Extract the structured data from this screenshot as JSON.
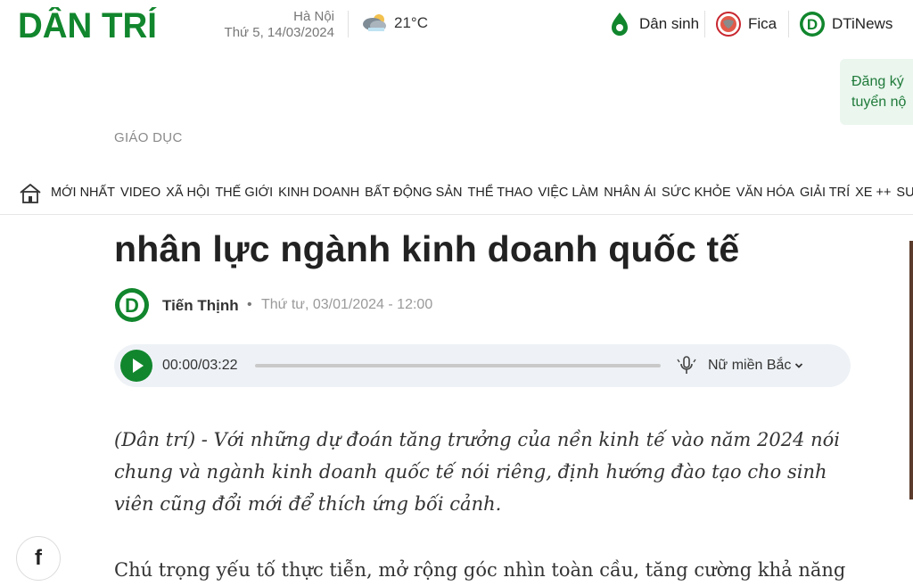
{
  "header": {
    "logo_text": "DÂN TRÍ",
    "location": "Hà Nội",
    "date": "Thứ 5, 14/03/2024",
    "temperature": "21°C",
    "links": [
      {
        "label": "Dân sinh",
        "icon": "dan-sinh-icon"
      },
      {
        "label": "Fica",
        "icon": "fica-globe-icon"
      },
      {
        "label": "DTiNews",
        "icon": "dtinews-logo-icon"
      }
    ],
    "side_cta": {
      "line1": "Đăng ký",
      "line2": "tuyển nộ"
    }
  },
  "breadcrumb": "GIÁO DỤC",
  "nav": {
    "home_icon": "home-icon",
    "items": [
      "MỚI NHẤT",
      "VIDEO",
      "XÃ HỘI",
      "THẾ GIỚI",
      "KINH DOANH",
      "BẤT ĐỘNG SẢN",
      "THỂ THAO",
      "VIỆC LÀM",
      "NHÂN ÁI",
      "SỨC KHỎE",
      "VĂN HÓA",
      "GIẢI TRÍ",
      "XE ++",
      "SU"
    ]
  },
  "article": {
    "headline_visible": "nhân lực ngành kinh doanh quốc tế",
    "author": "Tiến Thịnh",
    "separator": "•",
    "published": "Thứ tư, 03/01/2024 - 12:00",
    "sapo": "(Dân trí) - Với những dự đoán tăng trưởng của nền kinh tế vào năm 2024 nói chung và ngành kinh doanh quốc tế nói riêng, định hướng đào tạo cho sinh viên cũng đổi mới để thích ứng bối cảnh.",
    "body_first_line": "Chú trọng yếu tố thực tiễn, mở rộng góc nhìn toàn cầu, tăng cường khả năng"
  },
  "player": {
    "time": "00:00/03:22",
    "progress": 0,
    "voice": "Nữ miền Bắc"
  },
  "share": {
    "facebook_glyph": "f"
  },
  "colors": {
    "brand_green": "#11862d",
    "player_bg": "#eef2f6"
  }
}
